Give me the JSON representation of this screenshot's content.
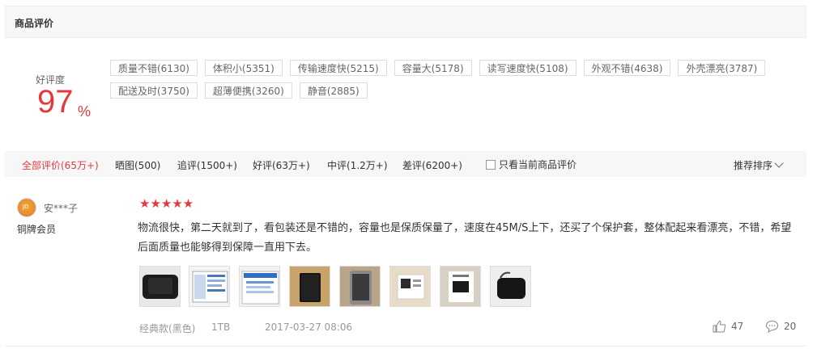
{
  "header": {
    "title": "商品评价"
  },
  "rating": {
    "label": "好评度",
    "value": "97",
    "unit": "%"
  },
  "tags": [
    "质量不错(6130)",
    "体积小(5351)",
    "传输速度快(5215)",
    "容量大(5178)",
    "读写速度快(5108)",
    "外观不错(4638)",
    "外壳漂亮(3787)",
    "配送及时(3750)",
    "超薄便携(3260)",
    "静音(2885)"
  ],
  "filters": {
    "all": "全部评价(65万+)",
    "pics": "晒图(500)",
    "followup": "追评(1500+)",
    "good": "好评(63万+)",
    "medium": "中评(1.2万+)",
    "bad": "差评(6200+)",
    "only_current": "只看当前商品评价",
    "sort": "推荐排序"
  },
  "review": {
    "username": "安***子",
    "member_level": "铜牌会员",
    "stars": "★★★★★",
    "rating_stars": 5,
    "content": "物流很快，第二天就到了，看包装还是不错的，容量也是保质保量了，速度在45M/S上下，还买了个保护套，整体配起来看漂亮，不错，希望后面质量也能够得到保障一直用下去。",
    "variant": "经典款(黑色)",
    "capacity": "1TB",
    "date": "2017-03-27 08:06",
    "likes": "47",
    "replies": "20"
  },
  "colors": {
    "accent": "#e4393c",
    "bar_bg": "#f7f7f7"
  }
}
